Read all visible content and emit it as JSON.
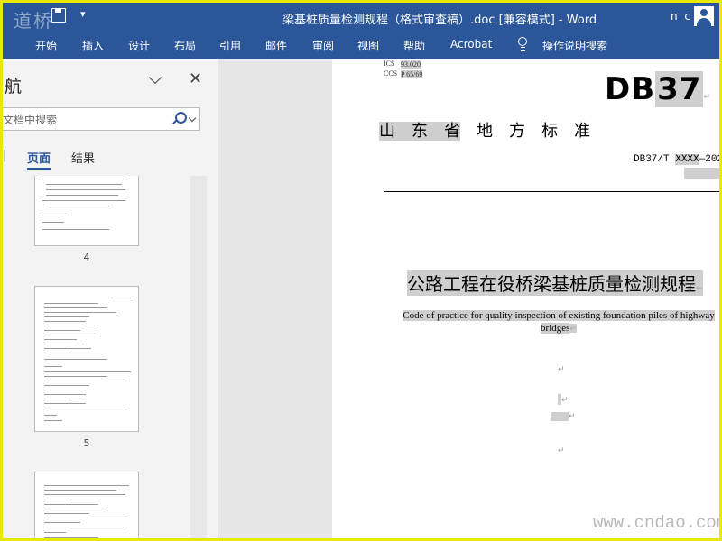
{
  "titlebar": {
    "logo": "道桥",
    "title": "梁基桩质量检测规程（格式审查稿）.doc [兼容模式] - Word",
    "user_initials": "n c"
  },
  "ribbon": {
    "tabs": [
      "开始",
      "插入",
      "设计",
      "布局",
      "引用",
      "邮件",
      "审阅",
      "视图",
      "帮助",
      "Acrobat"
    ],
    "tell_me": "操作说明搜索"
  },
  "nav": {
    "title": "航",
    "search_placeholder": "文档中搜索",
    "tabs": [
      "页面",
      "结果"
    ],
    "pages": [
      "4",
      "5"
    ]
  },
  "doc": {
    "ics_label": "ICS",
    "ics_value": "93.020",
    "ccs_label": "CCS",
    "ccs_value": "P 65/69",
    "db_prefix": "DB",
    "db_number": "37",
    "province_a": "山　东　省",
    "province_b": "　地　方　标　准",
    "std_prefix": "DB37/T ",
    "std_code": "XXXX",
    "std_year": "—202",
    "title_cn": "公路工程在役桥梁基桩质量检测规程",
    "title_en_1": "Code of practice for quality inspection of existing foundation piles of highway",
    "title_en_2": "bridges"
  },
  "watermark": "www.cndao.com",
  "colors": {
    "ribbon_blue": "#2b579a",
    "border_yellow": "#e8e800",
    "highlight_gray": "#cfcfcf"
  }
}
